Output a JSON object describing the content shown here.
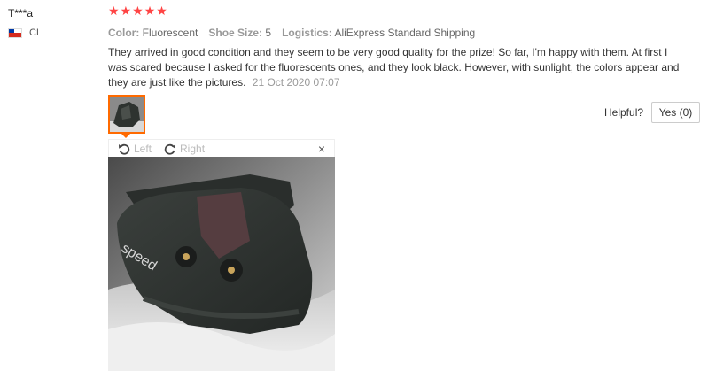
{
  "user": {
    "name": "T***a",
    "country": "CL"
  },
  "rating": {
    "stars": 5,
    "max": 5
  },
  "meta": [
    {
      "key": "Color:",
      "value": "Fluorescent"
    },
    {
      "key": "Shoe Size:",
      "value": "5"
    },
    {
      "key": "Logistics:",
      "value": "AliExpress Standard Shipping"
    }
  ],
  "review": {
    "text": "They arrived in good condition and they seem to be very good quality for the prize! So far, I'm happy with them. At first I was scared because I asked for the fluorescents ones, and they look black. However, with sunlight, the colors appear and they are just like the pictures.",
    "date": "21 Oct 2020 07:07"
  },
  "helpful": {
    "label": "Helpful?",
    "yes": "Yes (0)"
  },
  "viewer": {
    "left": "Left",
    "right": "Right",
    "close": "×"
  },
  "photo": {
    "brand_text": "speed"
  },
  "colors": {
    "accent": "#ff6a00",
    "star": "#ff4747"
  }
}
